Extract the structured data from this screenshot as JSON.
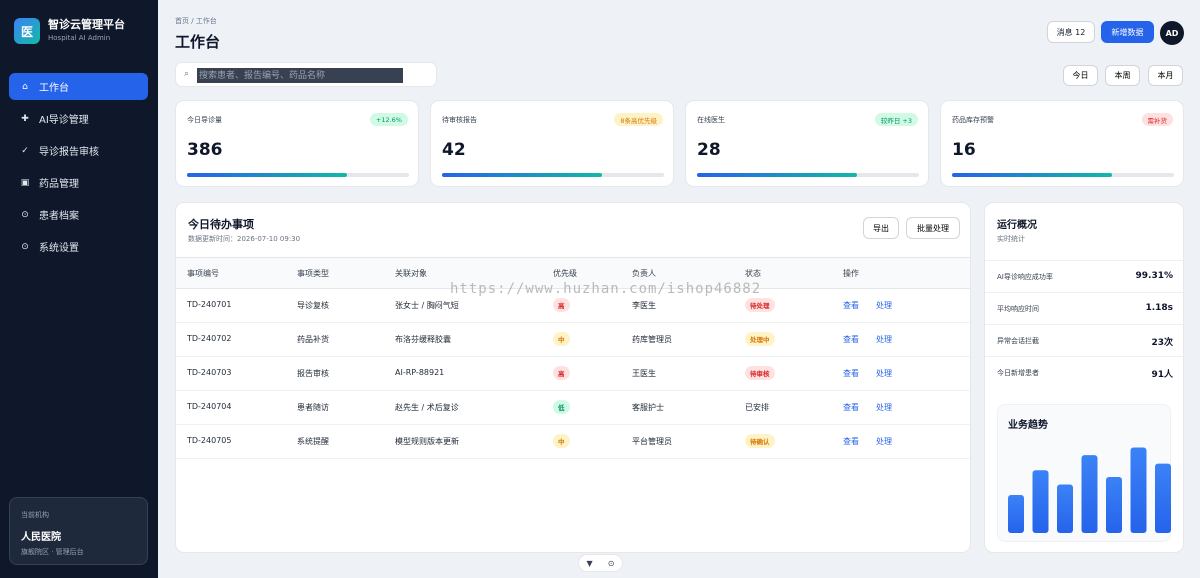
{
  "brand": {
    "logo": "医",
    "title": "智诊云管理平台",
    "subtitle": "Hospital AI Admin"
  },
  "nav": [
    {
      "label": "工作台",
      "icon": "home-icon",
      "glyph": "⌂",
      "active": true
    },
    {
      "label": "AI导诊管理",
      "icon": "plus-icon",
      "glyph": "✚",
      "active": false
    },
    {
      "label": "导诊报告审核",
      "icon": "check-icon",
      "glyph": "✓",
      "active": false
    },
    {
      "label": "药品管理",
      "icon": "box-icon",
      "glyph": "▣",
      "active": false
    },
    {
      "label": "患者档案",
      "icon": "target-icon",
      "glyph": "⊙",
      "active": false
    },
    {
      "label": "系统设置",
      "icon": "settings-icon",
      "glyph": "⊙",
      "active": false
    }
  ],
  "org": {
    "label": "当前机构",
    "name": "人民医院",
    "sub": "旗舰院区 · 管理后台"
  },
  "header": {
    "breadcrumb": "首页 / 工作台",
    "title": "工作台",
    "messages": "消息 12",
    "add": "新增数据",
    "avatar": "AD"
  },
  "search": {
    "placeholder": "搜索患者、报告编号、药品名称"
  },
  "range": [
    "今日",
    "本周",
    "本月"
  ],
  "stats": [
    {
      "label": "今日导诊量",
      "badge": "+12.6%",
      "badge_fg": "#059669",
      "badge_bg": "#d1fae5",
      "value": "386",
      "progress": 0.72
    },
    {
      "label": "待审核报告",
      "badge": "8条高优先级",
      "badge_fg": "#d97706",
      "badge_bg": "#fef3c7",
      "value": "42",
      "progress": 0.72
    },
    {
      "label": "在线医生",
      "badge": "较昨日 +3",
      "badge_fg": "#059669",
      "badge_bg": "#d1fae5",
      "value": "28",
      "progress": 0.72
    },
    {
      "label": "药品库存预警",
      "badge": "需补货",
      "badge_fg": "#dc2626",
      "badge_bg": "#fee2e2",
      "value": "16",
      "progress": 0.72
    }
  ],
  "todo": {
    "title": "今日待办事项",
    "updated": "数据更新时间：2026-07-10 09:30",
    "export": "导出",
    "batch": "批量处理",
    "columns": [
      "事项编号",
      "事项类型",
      "关联对象",
      "优先级",
      "负责人",
      "状态",
      "操作"
    ],
    "rows": [
      {
        "id": "TD-240701",
        "type": "导诊复核",
        "target": "张女士 / 胸闷气短",
        "priority": "高",
        "pri_fg": "#dc2626",
        "pri_bg": "#fee2e2",
        "owner": "李医生",
        "status": "待处理",
        "st_fg": "#dc2626",
        "st_bg": "#fee2e2",
        "view": "查看",
        "handle": "处理"
      },
      {
        "id": "TD-240702",
        "type": "药品补货",
        "target": "布洛芬缓释胶囊",
        "priority": "中",
        "pri_fg": "#d97706",
        "pri_bg": "#fef3c7",
        "owner": "药库管理员",
        "status": "处理中",
        "st_fg": "#d97706",
        "st_bg": "#fef3c7",
        "view": "查看",
        "handle": "处理"
      },
      {
        "id": "TD-240703",
        "type": "报告审核",
        "target": "AI-RP-88921",
        "priority": "高",
        "pri_fg": "#dc2626",
        "pri_bg": "#fee2e2",
        "owner": "王医生",
        "status": "待审核",
        "st_fg": "#dc2626",
        "st_bg": "#fee2e2",
        "view": "查看",
        "handle": "处理"
      },
      {
        "id": "TD-240704",
        "type": "患者随访",
        "target": "赵先生 / 术后复诊",
        "priority": "低",
        "pri_fg": "#059669",
        "pri_bg": "#d1fae5",
        "owner": "客服护士",
        "status": "已安排",
        "st_fg": "#1f2937",
        "st_bg": "transparent",
        "view": "查看",
        "handle": "处理"
      },
      {
        "id": "TD-240705",
        "type": "系统提醒",
        "target": "模型规则版本更新",
        "priority": "中",
        "pri_fg": "#d97706",
        "pri_bg": "#fef3c7",
        "owner": "平台管理员",
        "status": "待确认",
        "st_fg": "#d97706",
        "st_bg": "#fef3c7",
        "view": "查看",
        "handle": "处理"
      }
    ]
  },
  "watermark": "https://www.huzhan.com/ishop46882",
  "ops": {
    "title": "运行概况",
    "sub": "实时统计",
    "metrics": [
      {
        "label": "AI导诊响应成功率",
        "value": "99.31%"
      },
      {
        "label": "平均响应时间",
        "value": "1.18s"
      },
      {
        "label": "异常会话拦截",
        "value": "23次"
      },
      {
        "label": "今日新增患者",
        "value": "91人"
      }
    ],
    "trend_title": "业务趋势",
    "trend_values": [
      40,
      66,
      51,
      82,
      59,
      90,
      73
    ]
  },
  "bottom": {
    "filter_icon": "filter-icon",
    "target_icon": "target-icon"
  }
}
